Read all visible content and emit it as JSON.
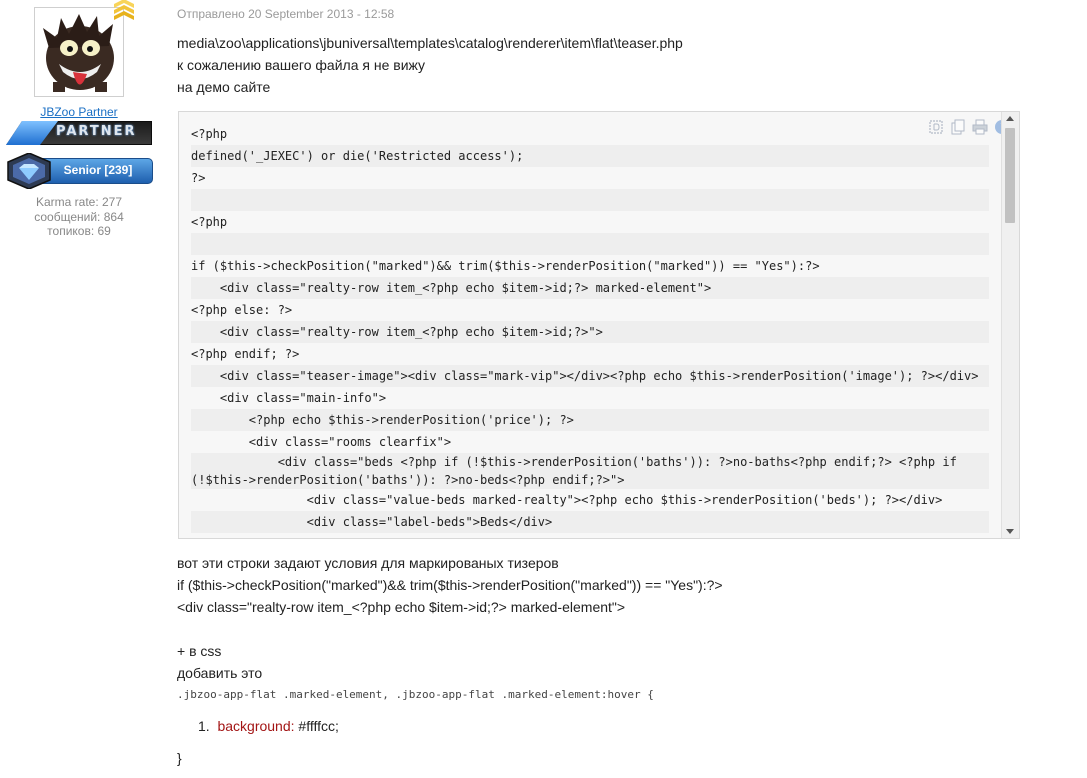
{
  "user": {
    "avatar_alt": "",
    "username": "JBZoo Partner",
    "partner_badge": "PARTNER",
    "rank_badge": "Senior [239]",
    "karma": "Karma rate: 277",
    "messages": "сообщений: 864",
    "topics": "топиков: 69"
  },
  "post": {
    "date": "Отправлено 20 September 2013 - 12:58",
    "intro": [
      "media\\zoo\\applications\\jbuniversal\\templates\\catalog\\renderer\\item\\flat\\teaser.php",
      "к сожалению вашего файла я не вижу",
      "на демо сайте"
    ],
    "code_lines": [
      "<?php",
      "defined('_JEXEC') or die('Restricted access');",
      "?>",
      "",
      "<?php",
      "",
      "if ($this->checkPosition(\"marked\")&& trim($this->renderPosition(\"marked\")) == \"Yes\"):?>",
      "    <div class=\"realty-row item_<?php echo $item->id;?> marked-element\">",
      "<?php else: ?>",
      "    <div class=\"realty-row item_<?php echo $item->id;?>\">",
      "<?php endif; ?>",
      "    <div class=\"teaser-image\"><div class=\"mark-vip\"></div><?php echo $this->renderPosition('image'); ?></div>",
      "    <div class=\"main-info\">",
      "        <?php echo $this->renderPosition('price'); ?>",
      "        <div class=\"rooms clearfix\">",
      "            <div class=\"beds <?php if (!$this->renderPosition('baths')): ?>no-baths<?php endif;?> <?php if (!$this->renderPosition('baths')): ?>no-beds<?php endif;?>\">",
      "                <div class=\"value-beds marked-realty\"><?php echo $this->renderPosition('beds'); ?></div>",
      "                <div class=\"label-beds\">Beds</div>"
    ],
    "after": [
      "вот эти строки задают условия для маркированых тизеров",
      "if ($this->checkPosition(\"marked\")&& trim($this->renderPosition(\"marked\")) == \"Yes\"):?>",
      "<div class=\"realty-row item_<?php echo $item->id;?> marked-element\">"
    ],
    "css_intro": "+ в css",
    "css_add": "добавить это",
    "css_selector": ".jbzoo-app-flat .marked-element, .jbzoo-app-flat .marked-element:hover {",
    "css_item_number": "1.",
    "css_prop": "background:",
    "css_value": " #ffffcc;",
    "css_close": "}"
  },
  "toolbar_icons": [
    "view-source-icon",
    "copy-icon",
    "print-icon",
    "info-icon"
  ]
}
